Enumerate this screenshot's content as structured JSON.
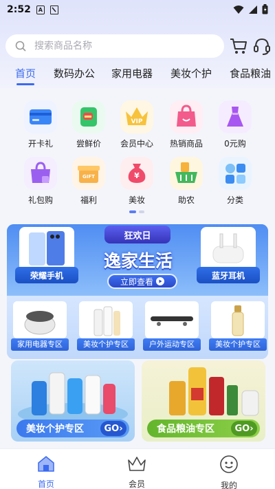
{
  "status": {
    "time": "2:52",
    "icon_a": "A"
  },
  "search": {
    "placeholder": "搜索商品名称"
  },
  "tabs": [
    {
      "label": "首页"
    },
    {
      "label": "数码办公"
    },
    {
      "label": "家用电器"
    },
    {
      "label": "美妆个护"
    },
    {
      "label": "食品粮油"
    }
  ],
  "categories": [
    {
      "label": "开卡礼",
      "icon": "credit-card-icon"
    },
    {
      "label": "尝鲜价",
      "icon": "fresh-bag-icon"
    },
    {
      "label": "会员中心",
      "icon": "vip-crown-icon",
      "badge": "VIP"
    },
    {
      "label": "热销商品",
      "icon": "hot-bag-icon"
    },
    {
      "label": "0元购",
      "icon": "dress-icon"
    },
    {
      "label": "礼包购",
      "icon": "gift-bag-icon"
    },
    {
      "label": "福利",
      "icon": "gift-box-icon",
      "badge": "GIFT"
    },
    {
      "label": "美妆",
      "icon": "money-bag-icon",
      "badge": "¥"
    },
    {
      "label": "助农",
      "icon": "basket-icon"
    },
    {
      "label": "分类",
      "icon": "grid-icon"
    }
  ],
  "banner": {
    "ribbon": "狂欢日",
    "headline": "逸家生活",
    "cta": "立即查看",
    "left_product": "荣耀手机",
    "right_product": "蓝牙耳机",
    "sub_categories": [
      {
        "label": "家用电器专区"
      },
      {
        "label": "美妆个护专区"
      },
      {
        "label": "户外运动专区"
      },
      {
        "label": "美妆个护专区"
      }
    ]
  },
  "promos": [
    {
      "label": "美妆个护专区",
      "go": "GO"
    },
    {
      "label": "食品粮油专区",
      "go": "GO"
    }
  ],
  "tabbar": [
    {
      "label": "首页",
      "icon": "home-icon"
    },
    {
      "label": "会员",
      "icon": "crown-icon"
    },
    {
      "label": "我的",
      "icon": "smile-icon"
    }
  ],
  "colors": {
    "accent": "#3a6af0",
    "promo_blue": "#4a7cf2",
    "promo_green": "#7cc43c"
  }
}
